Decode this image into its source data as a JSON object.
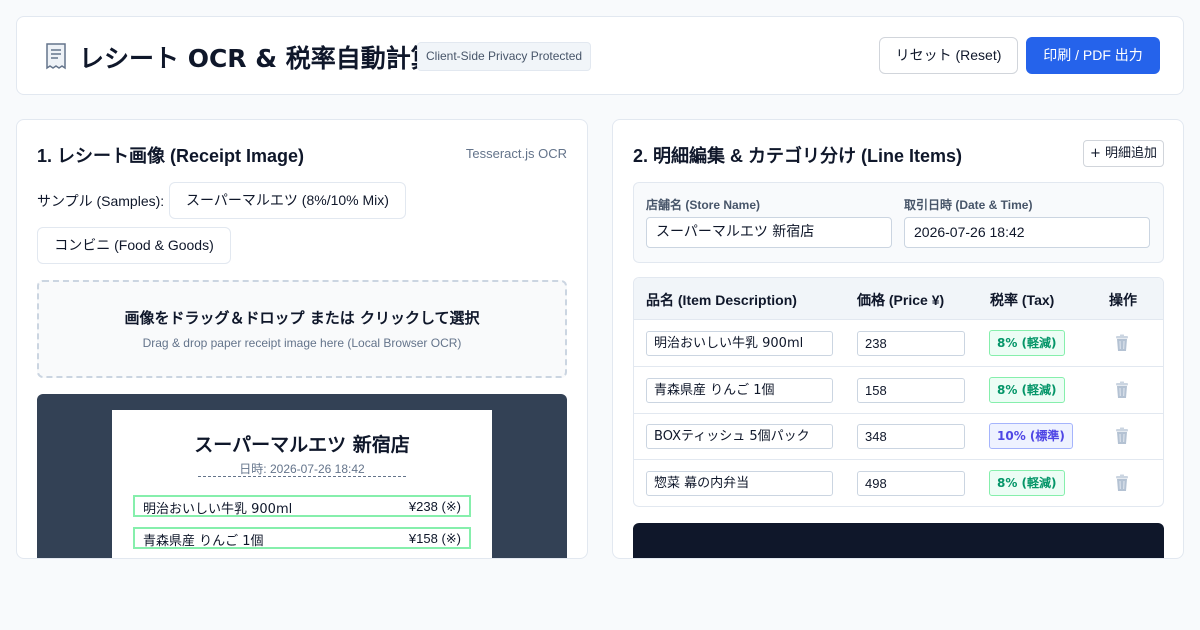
{
  "header": {
    "icon": "receipt-icon",
    "title": "レシート OCR & 税率自動計算",
    "privacy_badge": "Client-Side Privacy Protected",
    "reset_label": "リセット (Reset)",
    "print_label": "印刷 / PDF 出力",
    "colors": {
      "primary": "#2563eb"
    }
  },
  "left": {
    "title": "1. レシート画像 (Receipt Image)",
    "engine": "Tesseract.js OCR",
    "samples_label": "サンプル (Samples):",
    "samples": [
      "スーパーマルエツ (8%/10% Mix)",
      "コンビニ (Food & Goods)"
    ],
    "dropzone": {
      "title": "画像をドラッグ＆ドロップ または クリックして選択",
      "subtitle": "Drag & drop paper receipt image here (Local Browser OCR)"
    },
    "receipt": {
      "store": "スーパーマルエツ 新宿店",
      "date_label": "日時:",
      "date": "2026-07-26 18:42",
      "lines": [
        {
          "name": "明治おいしい牛乳 900ml",
          "price": "¥238 (※)"
        },
        {
          "name": "青森県産 りんご 1個",
          "price": "¥158 (※)"
        }
      ]
    }
  },
  "right": {
    "title": "2. 明細編集 & カテゴリ分け (Line Items)",
    "add_label": "+ 明細追加",
    "store_label": "店舗名 (Store Name)",
    "store_value": "スーパーマルエツ 新宿店",
    "date_label": "取引日時 (Date & Time)",
    "date_value": "2026-07-26 18:42",
    "table": {
      "columns": [
        "品名 (Item Description)",
        "価格 (Price ¥)",
        "税率 (Tax)",
        "操作"
      ],
      "rows": [
        {
          "name": "明治おいしい牛乳 900ml",
          "price": "238",
          "tax": "8% (軽減)"
        },
        {
          "name": "青森県産 りんご 1個",
          "price": "158",
          "tax": "8% (軽減)"
        },
        {
          "name": "BOXティッシュ 5個パック",
          "price": "348",
          "tax": "10% (標準)"
        },
        {
          "name": "惣菜 幕の内弁当",
          "price": "498",
          "tax": "8% (軽減)"
        }
      ]
    },
    "delete_icon": "trash-icon"
  }
}
